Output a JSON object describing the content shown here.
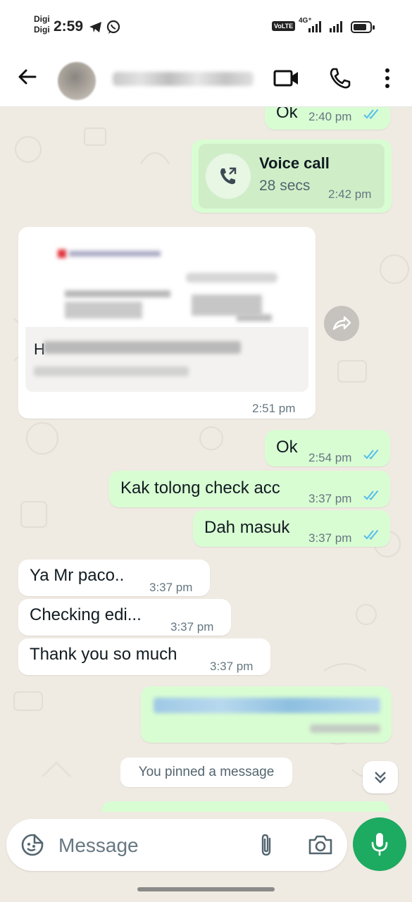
{
  "status_bar": {
    "carrier_1": "Digi",
    "carrier_2": "Digi",
    "time": "2:59",
    "volte": "VoLTE",
    "network": "4G⁺"
  },
  "header": {
    "contact_name": "",
    "icons": [
      "back-arrow-icon",
      "video-call-icon",
      "phone-icon",
      "more-vert-icon"
    ]
  },
  "messages": [
    {
      "type": "outgoing",
      "text": "Ok",
      "time": "2:40 pm",
      "read": true
    },
    {
      "type": "outgoing-call",
      "title": "Voice call",
      "duration": "28 secs",
      "time": "2:42 pm"
    },
    {
      "type": "incoming-document",
      "caption": "H",
      "time": "2:51 pm"
    },
    {
      "type": "outgoing",
      "text": "Ok",
      "time": "2:54 pm",
      "read": true
    },
    {
      "type": "outgoing",
      "text": "Kak tolong check acc",
      "time": "3:37 pm",
      "read": true
    },
    {
      "type": "outgoing",
      "text": "Dah masuk",
      "time": "3:37 pm",
      "read": true
    },
    {
      "type": "incoming",
      "text": "Ya Mr paco..",
      "time": "3:37 pm"
    },
    {
      "type": "incoming",
      "text": "Checking edi...",
      "time": "3:37 pm"
    },
    {
      "type": "incoming",
      "text": "Thank you so much",
      "time": "3:37 pm"
    },
    {
      "type": "outgoing-link",
      "text": "",
      "time": "",
      "read": true
    }
  ],
  "pinned_notice": "You pinned a message",
  "input": {
    "placeholder": "Message"
  },
  "colors": {
    "outgoing_bubble": "#d9fdd3",
    "incoming_bubble": "#ffffff",
    "chat_background": "#efeae2",
    "accent_green": "#1daa61",
    "read_tick_blue": "#53bdeb"
  }
}
